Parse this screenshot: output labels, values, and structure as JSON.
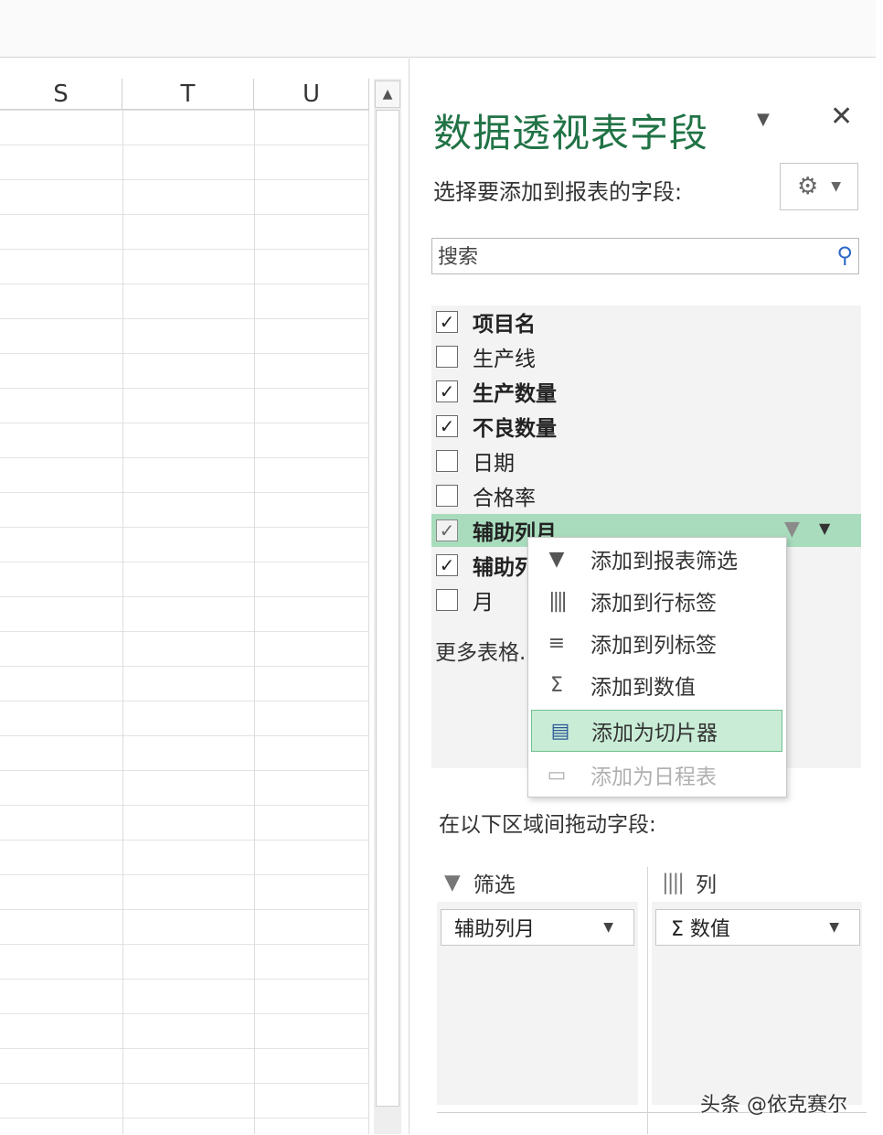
{
  "sheet": {
    "columns": [
      "S",
      "T",
      "U"
    ]
  },
  "pane": {
    "title": "数据透视表字段",
    "subtitle": "选择要添加到报表的字段:",
    "search_placeholder": "搜索",
    "fields": [
      {
        "label": "项目名",
        "checked": true
      },
      {
        "label": "生产线",
        "checked": false
      },
      {
        "label": "生产数量",
        "checked": true
      },
      {
        "label": "不良数量",
        "checked": true
      },
      {
        "label": "日期",
        "checked": false
      },
      {
        "label": "合格率",
        "checked": false
      },
      {
        "label": "辅助列月",
        "checked": true
      },
      {
        "label": "辅助列",
        "checked": true
      },
      {
        "label": "月",
        "checked": false
      }
    ],
    "more_tables": "更多表格...",
    "drag_label": "在以下区域间拖动字段:",
    "areas": {
      "filter": {
        "title": "筛选",
        "item": "辅助列月"
      },
      "columns": {
        "title": "列",
        "item": "Σ  数值"
      }
    }
  },
  "context_menu": {
    "items": [
      {
        "label": "添加到报表筛选",
        "icon": "filter-icon"
      },
      {
        "label": "添加到行标签",
        "icon": "row-labels-icon"
      },
      {
        "label": "添加到列标签",
        "icon": "column-labels-icon"
      },
      {
        "label": "添加到数值",
        "icon": "sigma-icon"
      },
      {
        "label": "添加为切片器",
        "icon": "slicer-icon"
      },
      {
        "label": "添加为日程表",
        "icon": "timeline-icon"
      }
    ]
  },
  "watermark": "头条 @依克赛尔",
  "colors": {
    "title_green": "#217346",
    "highlight_green": "#a8dcbd",
    "menu_active": "#c9ecd6"
  }
}
